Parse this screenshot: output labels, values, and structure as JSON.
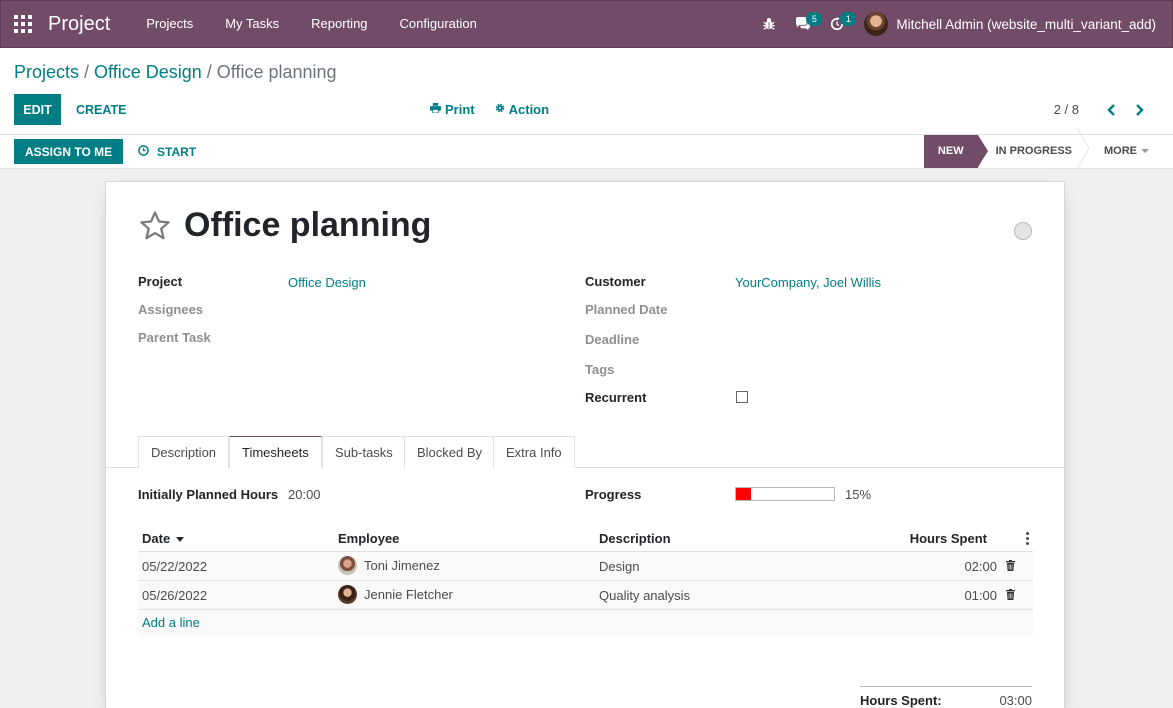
{
  "navbar": {
    "app_name": "Project",
    "menu": [
      "Projects",
      "My Tasks",
      "Reporting",
      "Configuration"
    ],
    "messages_badge": "5",
    "activities_badge": "1",
    "user_name": "Mitchell Admin (website_multi_variant_add)"
  },
  "breadcrumb": {
    "level1": "Projects",
    "level2": "Office Design",
    "current": "Office planning",
    "sep": "/"
  },
  "control_panel": {
    "edit_label": "EDIT",
    "create_label": "CREATE",
    "print_label": "Print",
    "action_label": "Action",
    "pager_value": "2 / 8"
  },
  "statusbar": {
    "assign_label": "ASSIGN TO ME",
    "start_label": "START",
    "stages": [
      "NEW",
      "IN PROGRESS",
      "MORE"
    ],
    "active_stage": "NEW"
  },
  "form": {
    "title": "Office planning",
    "left_fields": {
      "project_label": "Project",
      "project_value": "Office Design",
      "assignees_label": "Assignees",
      "parent_task_label": "Parent Task"
    },
    "right_fields": {
      "customer_label": "Customer",
      "customer_value": "YourCompany, Joel Willis",
      "planned_date_label": "Planned Date",
      "deadline_label": "Deadline",
      "tags_label": "Tags",
      "recurrent_label": "Recurrent",
      "recurrent_checked": false
    },
    "tabs": [
      "Description",
      "Timesheets",
      "Sub-tasks",
      "Blocked By",
      "Extra Info"
    ],
    "active_tab": "Timesheets"
  },
  "timesheets": {
    "planned_hours_label": "Initially Planned Hours",
    "planned_hours_value": "20:00",
    "progress_label": "Progress",
    "progress_value": 15,
    "progress_text": "15%",
    "progress_color": "#ff0000",
    "columns": [
      "Date",
      "Employee",
      "Description",
      "Hours Spent"
    ],
    "rows": [
      {
        "date": "05/22/2022",
        "employee": "Toni Jimenez",
        "description": "Design",
        "hours": "02:00"
      },
      {
        "date": "05/26/2022",
        "employee": "Jennie Fletcher",
        "description": "Quality analysis",
        "hours": "01:00"
      }
    ],
    "add_line_label": "Add a line",
    "total_label": "Hours Spent:",
    "total_value": "03:00"
  },
  "colors": {
    "brand": "#714b67",
    "accent": "#017e84"
  }
}
